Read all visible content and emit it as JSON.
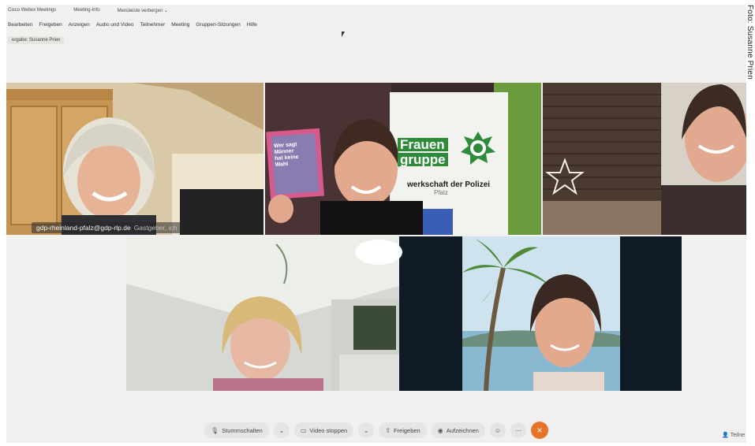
{
  "window": {
    "title_items": [
      "Cisco Webex Meetings",
      "Meeting-Info",
      "Menüleiste verbergen ⌄"
    ]
  },
  "menu": {
    "items": [
      "Bearbeiten",
      "Freigeben",
      "Anzeigen",
      "Audio und Video",
      "Teilnehmer",
      "Meeting",
      "Gruppen-Sitzungen",
      "Hilfe"
    ]
  },
  "presenter": {
    "label": "ergabe: Susanne Prien"
  },
  "tiles": {
    "host_name": "gdp-rheinland-pfalz@gdp-rlp.de",
    "host_tag": "Gastgeber, ich",
    "banner_line1": "Frauen",
    "banner_line2": "gruppe",
    "banner_sub1": "werkschaft der Polizei",
    "banner_sub2": "Pfalz",
    "card_line1": "Wer sagt",
    "card_line2": "Männer",
    "card_line3": "hat keine",
    "card_line4": "Wahl"
  },
  "controls": {
    "mute": "Stummschalten",
    "video": "Video stoppen",
    "share": "Freigeben",
    "record": "Aufzeichnen",
    "participants": "Teilne"
  },
  "credit": "Foto: Susanne Prien",
  "colors": {
    "active_border": "#5fb7e0",
    "end_call": "#e8742a",
    "gdp_green": "#2e8b3a"
  }
}
